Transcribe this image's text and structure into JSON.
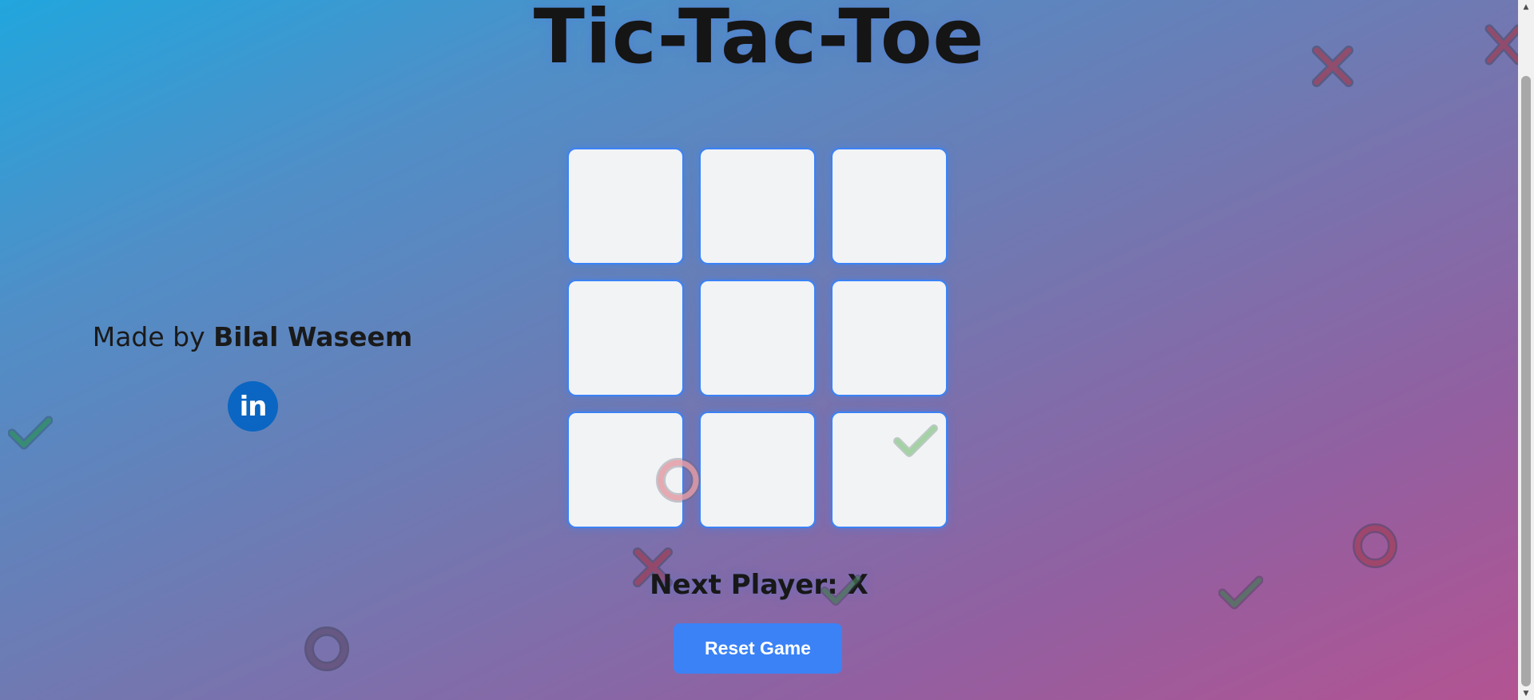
{
  "title": "Tic-Tac-Toe",
  "board": {
    "cells": [
      "",
      "",
      "",
      "",
      "",
      "",
      "",
      "",
      ""
    ]
  },
  "status": {
    "text": "Next Player: X"
  },
  "reset_button": {
    "label": "Reset Game"
  },
  "credit": {
    "prefix": "Made by",
    "author": "Bilal Waseem"
  },
  "social": {
    "linkedin_label": "in",
    "linkedin_icon": "linkedin-icon"
  },
  "decorations": [
    {
      "name": "x-mark-icon",
      "color": "#c0405a"
    },
    {
      "name": "circle-mark-icon",
      "color": "#d9405a"
    },
    {
      "name": "check-mark-icon",
      "color": "#2e9e5c"
    }
  ],
  "colors": {
    "accent": "#3b82f6",
    "cell_background": "#f2f3f5",
    "linkedin": "#0a66c2",
    "gradient_start": "#21a6dd",
    "gradient_end": "#b35392"
  }
}
